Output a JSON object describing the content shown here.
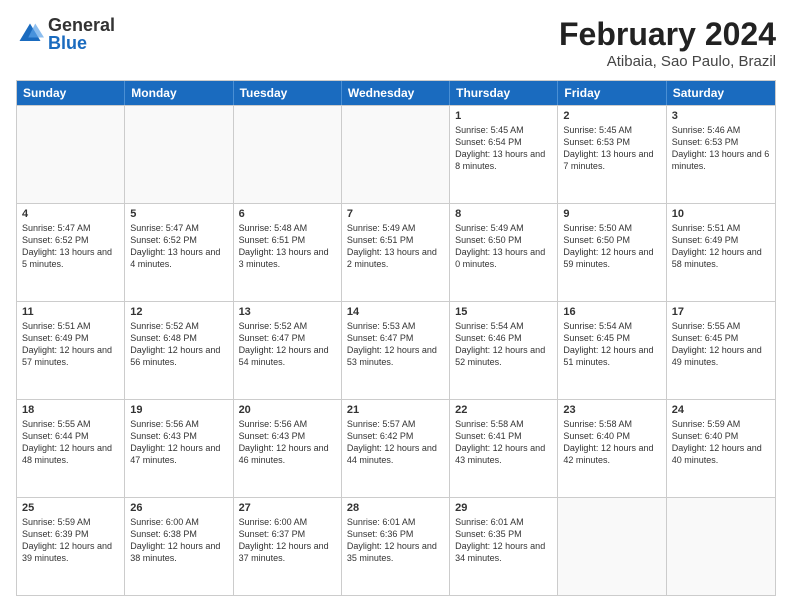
{
  "logo": {
    "general": "General",
    "blue": "Blue"
  },
  "title": "February 2024",
  "subtitle": "Atibaia, Sao Paulo, Brazil",
  "header_days": [
    "Sunday",
    "Monday",
    "Tuesday",
    "Wednesday",
    "Thursday",
    "Friday",
    "Saturday"
  ],
  "rows": [
    [
      {
        "day": "",
        "empty": true
      },
      {
        "day": "",
        "empty": true
      },
      {
        "day": "",
        "empty": true
      },
      {
        "day": "",
        "empty": true
      },
      {
        "day": "1",
        "sunrise": "5:45 AM",
        "sunset": "6:54 PM",
        "daylight": "13 hours and 8 minutes."
      },
      {
        "day": "2",
        "sunrise": "5:45 AM",
        "sunset": "6:53 PM",
        "daylight": "13 hours and 7 minutes."
      },
      {
        "day": "3",
        "sunrise": "5:46 AM",
        "sunset": "6:53 PM",
        "daylight": "13 hours and 6 minutes."
      }
    ],
    [
      {
        "day": "4",
        "sunrise": "5:47 AM",
        "sunset": "6:52 PM",
        "daylight": "13 hours and 5 minutes."
      },
      {
        "day": "5",
        "sunrise": "5:47 AM",
        "sunset": "6:52 PM",
        "daylight": "13 hours and 4 minutes."
      },
      {
        "day": "6",
        "sunrise": "5:48 AM",
        "sunset": "6:51 PM",
        "daylight": "13 hours and 3 minutes."
      },
      {
        "day": "7",
        "sunrise": "5:49 AM",
        "sunset": "6:51 PM",
        "daylight": "13 hours and 2 minutes."
      },
      {
        "day": "8",
        "sunrise": "5:49 AM",
        "sunset": "6:50 PM",
        "daylight": "13 hours and 0 minutes."
      },
      {
        "day": "9",
        "sunrise": "5:50 AM",
        "sunset": "6:50 PM",
        "daylight": "12 hours and 59 minutes."
      },
      {
        "day": "10",
        "sunrise": "5:51 AM",
        "sunset": "6:49 PM",
        "daylight": "12 hours and 58 minutes."
      }
    ],
    [
      {
        "day": "11",
        "sunrise": "5:51 AM",
        "sunset": "6:49 PM",
        "daylight": "12 hours and 57 minutes."
      },
      {
        "day": "12",
        "sunrise": "5:52 AM",
        "sunset": "6:48 PM",
        "daylight": "12 hours and 56 minutes."
      },
      {
        "day": "13",
        "sunrise": "5:52 AM",
        "sunset": "6:47 PM",
        "daylight": "12 hours and 54 minutes."
      },
      {
        "day": "14",
        "sunrise": "5:53 AM",
        "sunset": "6:47 PM",
        "daylight": "12 hours and 53 minutes."
      },
      {
        "day": "15",
        "sunrise": "5:54 AM",
        "sunset": "6:46 PM",
        "daylight": "12 hours and 52 minutes."
      },
      {
        "day": "16",
        "sunrise": "5:54 AM",
        "sunset": "6:45 PM",
        "daylight": "12 hours and 51 minutes."
      },
      {
        "day": "17",
        "sunrise": "5:55 AM",
        "sunset": "6:45 PM",
        "daylight": "12 hours and 49 minutes."
      }
    ],
    [
      {
        "day": "18",
        "sunrise": "5:55 AM",
        "sunset": "6:44 PM",
        "daylight": "12 hours and 48 minutes."
      },
      {
        "day": "19",
        "sunrise": "5:56 AM",
        "sunset": "6:43 PM",
        "daylight": "12 hours and 47 minutes."
      },
      {
        "day": "20",
        "sunrise": "5:56 AM",
        "sunset": "6:43 PM",
        "daylight": "12 hours and 46 minutes."
      },
      {
        "day": "21",
        "sunrise": "5:57 AM",
        "sunset": "6:42 PM",
        "daylight": "12 hours and 44 minutes."
      },
      {
        "day": "22",
        "sunrise": "5:58 AM",
        "sunset": "6:41 PM",
        "daylight": "12 hours and 43 minutes."
      },
      {
        "day": "23",
        "sunrise": "5:58 AM",
        "sunset": "6:40 PM",
        "daylight": "12 hours and 42 minutes."
      },
      {
        "day": "24",
        "sunrise": "5:59 AM",
        "sunset": "6:40 PM",
        "daylight": "12 hours and 40 minutes."
      }
    ],
    [
      {
        "day": "25",
        "sunrise": "5:59 AM",
        "sunset": "6:39 PM",
        "daylight": "12 hours and 39 minutes."
      },
      {
        "day": "26",
        "sunrise": "6:00 AM",
        "sunset": "6:38 PM",
        "daylight": "12 hours and 38 minutes."
      },
      {
        "day": "27",
        "sunrise": "6:00 AM",
        "sunset": "6:37 PM",
        "daylight": "12 hours and 37 minutes."
      },
      {
        "day": "28",
        "sunrise": "6:01 AM",
        "sunset": "6:36 PM",
        "daylight": "12 hours and 35 minutes."
      },
      {
        "day": "29",
        "sunrise": "6:01 AM",
        "sunset": "6:35 PM",
        "daylight": "12 hours and 34 minutes."
      },
      {
        "day": "",
        "empty": true
      },
      {
        "day": "",
        "empty": true
      }
    ]
  ]
}
